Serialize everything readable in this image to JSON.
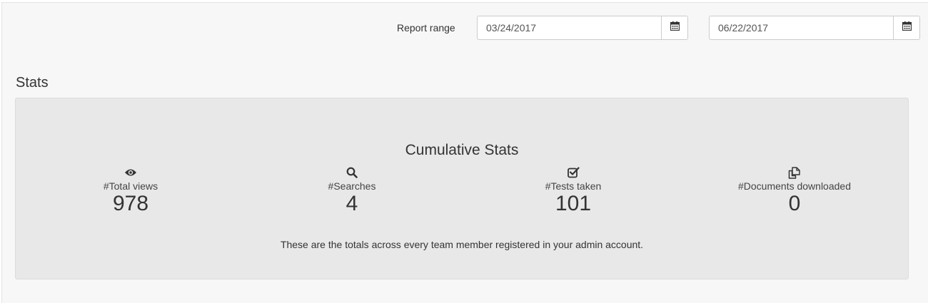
{
  "report_range": {
    "label": "Report range",
    "start_date": "03/24/2017",
    "end_date": "06/22/2017",
    "calendar_icon": "calendar-icon"
  },
  "stats": {
    "heading": "Stats",
    "panel_title": "Cumulative Stats",
    "items": [
      {
        "icon": "eye-icon",
        "label": "#Total views",
        "value": "978"
      },
      {
        "icon": "search-icon",
        "label": "#Searches",
        "value": "4"
      },
      {
        "icon": "checkbox-icon",
        "label": "#Tests taken",
        "value": "101"
      },
      {
        "icon": "copy-documents-icon",
        "label": "#Documents downloaded",
        "value": "0"
      }
    ],
    "footnote": "These are the totals across every team member registered in your admin account."
  }
}
